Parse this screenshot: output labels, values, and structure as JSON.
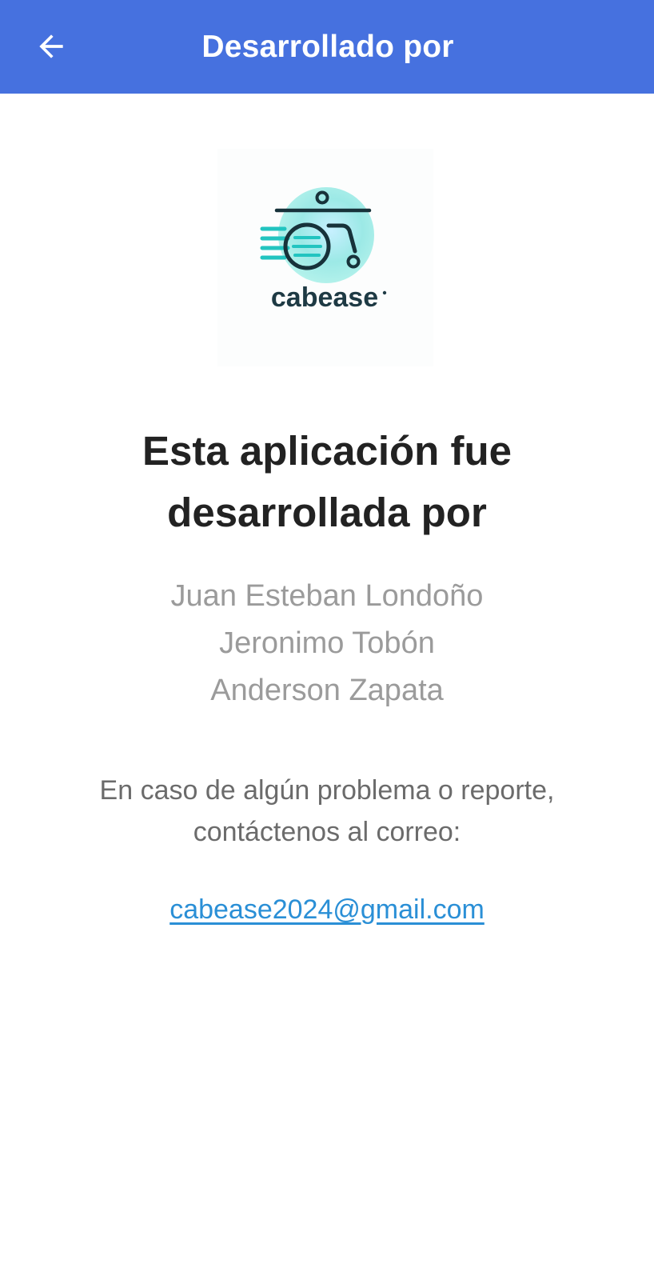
{
  "app_bar": {
    "title": "Desarrollado por",
    "back_icon": "arrow-left-icon",
    "background_color": "#4671DF"
  },
  "logo": {
    "brand_text": "cabease",
    "icon": "wheelchair-logo-icon"
  },
  "main": {
    "heading_line1": "Esta aplicación fue",
    "heading_line2": "desarrollada por",
    "developers": [
      "Juan Esteban Londoño",
      "Jeronimo Tobón",
      "Anderson Zapata"
    ],
    "contact_line1": "En caso de algún problema o reporte,",
    "contact_line2": "contáctenos al correo:",
    "email": "cabease2024@gmail.com",
    "link_color": "#2a8fd6"
  }
}
